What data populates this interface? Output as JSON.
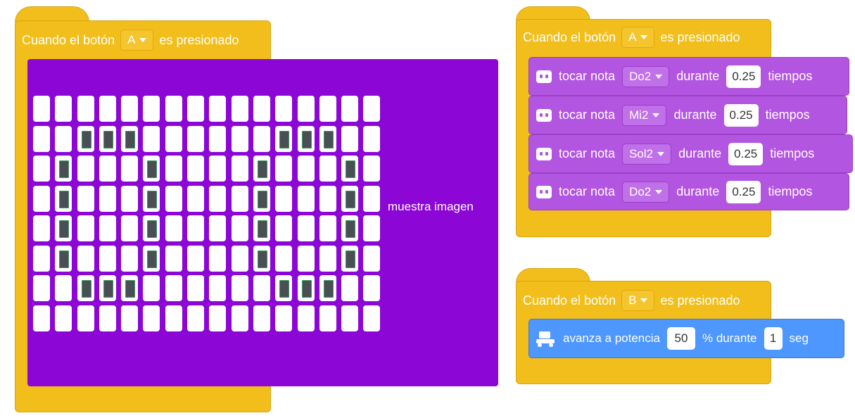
{
  "block_a_matrix": {
    "hat_label": "Cuando el botón",
    "button_value": "A",
    "hat_suffix": "es presionado",
    "command_label": "muestra imagen",
    "matrix_rows": [
      [
        0,
        0,
        0,
        0,
        0,
        0,
        0,
        0,
        0,
        0,
        0,
        0,
        0,
        0,
        0,
        0
      ],
      [
        0,
        0,
        1,
        1,
        1,
        0,
        0,
        0,
        0,
        0,
        0,
        1,
        1,
        1,
        0,
        0
      ],
      [
        0,
        1,
        0,
        0,
        0,
        1,
        0,
        0,
        0,
        0,
        1,
        0,
        0,
        0,
        1,
        0
      ],
      [
        0,
        1,
        0,
        0,
        0,
        1,
        0,
        0,
        0,
        0,
        1,
        0,
        0,
        0,
        1,
        0
      ],
      [
        0,
        1,
        0,
        0,
        0,
        1,
        0,
        0,
        0,
        0,
        1,
        0,
        0,
        0,
        1,
        0
      ],
      [
        0,
        1,
        0,
        0,
        0,
        1,
        0,
        0,
        0,
        0,
        1,
        0,
        0,
        0,
        1,
        0
      ],
      [
        0,
        0,
        1,
        1,
        1,
        0,
        0,
        0,
        0,
        0,
        0,
        1,
        1,
        1,
        0,
        0
      ],
      [
        0,
        0,
        0,
        0,
        0,
        0,
        0,
        0,
        0,
        0,
        0,
        0,
        0,
        0,
        0,
        0
      ]
    ]
  },
  "block_a_notes": {
    "hat_label": "Cuando el botón",
    "button_value": "A",
    "hat_suffix": "es presionado",
    "notes": [
      {
        "label": "tocar nota",
        "note": "Do2",
        "during": "durante",
        "duration": "0.25",
        "unit": "tiempos"
      },
      {
        "label": "tocar nota",
        "note": "Mi2",
        "during": "durante",
        "duration": "0.25",
        "unit": "tiempos"
      },
      {
        "label": "tocar nota",
        "note": "Sol2",
        "during": "durante",
        "duration": "0.25",
        "unit": "tiempos"
      },
      {
        "label": "tocar nota",
        "note": "Do2",
        "during": "durante",
        "duration": "0.25",
        "unit": "tiempos"
      }
    ]
  },
  "block_b_motor": {
    "hat_label": "Cuando el botón",
    "button_value": "B",
    "hat_suffix": "es presionado",
    "command": {
      "label": "avanza a potencia",
      "power": "50",
      "middle": "% durante",
      "seconds": "1",
      "unit": "seg"
    }
  },
  "colors": {
    "event": "#f2be1c",
    "sound": "#b255e0",
    "matrix": "#8c06d6",
    "motion": "#4d97ff",
    "led_on": "#4a4f55"
  }
}
